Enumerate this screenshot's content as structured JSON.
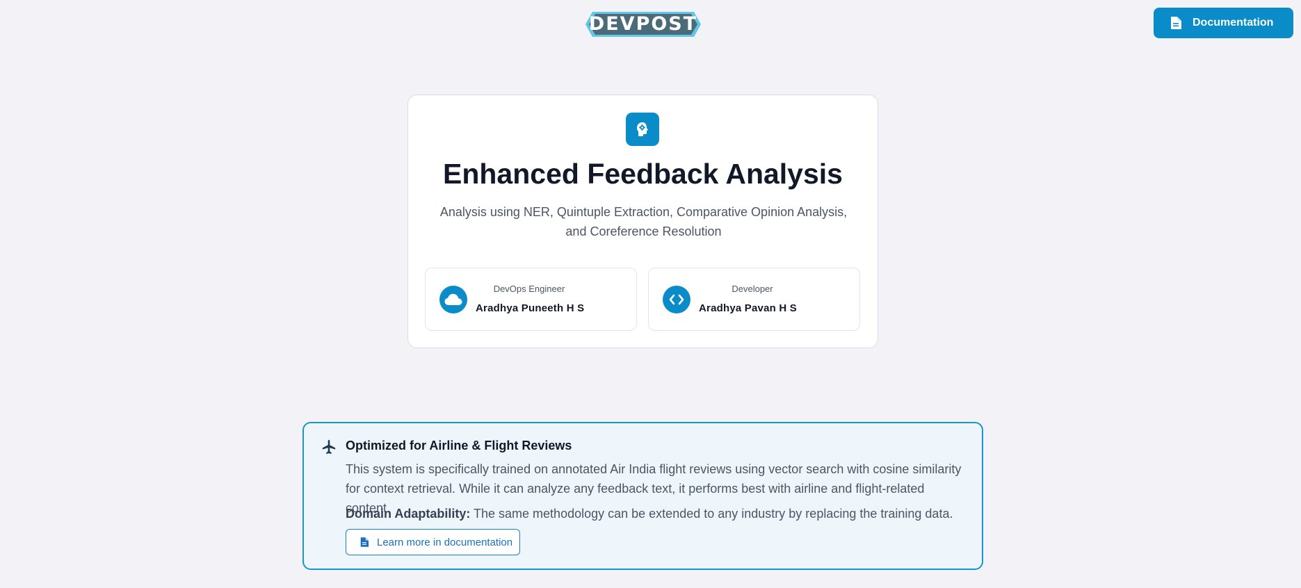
{
  "header": {
    "logo_text": "DEVPOST",
    "documentation_label": "Documentation"
  },
  "hero": {
    "title": "Enhanced Feedback Analysis",
    "subtitle_line1": "Analysis using NER, Quintuple Extraction, Comparative Opinion Analysis,",
    "subtitle_line2": "and Coreference Resolution",
    "icon": "brain-gear-icon",
    "team": [
      {
        "role": "DevOps Engineer",
        "name": "Aradhya Puneeth H S",
        "icon": "cloud-icon"
      },
      {
        "role": "Developer",
        "name": "Aradhya Pavan H S",
        "icon": "code-icon"
      }
    ]
  },
  "info": {
    "icon": "plane-icon",
    "title": "Optimized for Airline & Flight Reviews",
    "description": "This system is specifically trained on annotated Air India flight reviews using vector search with cosine similarity for context retrieval. While it can analyze any feedback text, it performs best with airline and flight-related content.",
    "domain_label": "Domain Adaptability:",
    "domain_text": " The same methodology can be extended to any industry by replacing the training data.",
    "learn_more_label": "Learn more in documentation"
  },
  "colors": {
    "accent": "#0a8cc8",
    "background": "#f3f3f7",
    "logo_dark": "#4b6b78",
    "logo_light": "#61c6e8"
  }
}
